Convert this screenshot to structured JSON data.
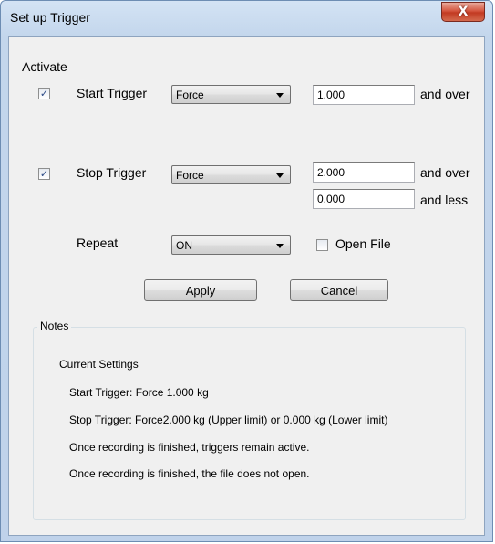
{
  "window": {
    "title": "Set up Trigger",
    "close_label": "X"
  },
  "activate_label": "Activate",
  "start_trigger": {
    "label": "Start Trigger",
    "checked": true,
    "type": "Force",
    "value": "1.000",
    "suffix": "and over"
  },
  "stop_trigger": {
    "label": "Stop Trigger",
    "checked": true,
    "type": "Force",
    "upper_value": "2.000",
    "upper_suffix": "and over",
    "lower_value": "0.000",
    "lower_suffix": "and less"
  },
  "repeat": {
    "label": "Repeat",
    "value": "ON"
  },
  "open_file": {
    "label": "Open File",
    "checked": false
  },
  "buttons": {
    "apply": "Apply",
    "cancel": "Cancel"
  },
  "notes": {
    "title": "Notes",
    "heading": "Current Settings",
    "lines": [
      "Start Trigger: Force 1.000 kg",
      "Stop Trigger: Force2.000 kg (Upper limit) or  0.000 kg (Lower limit)",
      "Once recording is finished, triggers remain active.",
      "Once recording is finished, the file does not open."
    ]
  },
  "colors": {
    "title_bar": "#c3d6ec",
    "client_bg": "#f0f0f0",
    "close_button": "#c23a22",
    "check_mark": "#2b4a86"
  }
}
